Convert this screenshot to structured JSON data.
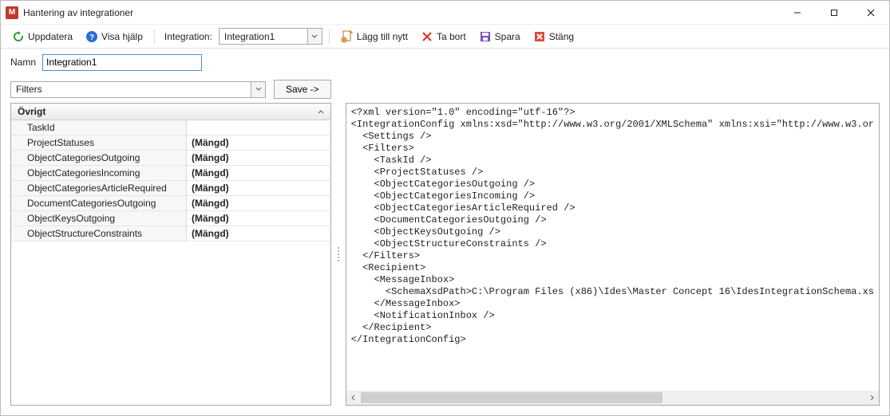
{
  "title": "Hantering av integrationer",
  "toolbar": {
    "update": "Uppdatera",
    "help": "Visa hjälp",
    "integration_label": "Integration:",
    "integration_value": "Integration1",
    "add_new": "Lägg till nytt",
    "delete": "Ta bort",
    "save": "Spara",
    "close": "Stäng"
  },
  "name_label": "Namn",
  "name_value": "Integration1",
  "filters_combo": "Filters",
  "save_arrow": "Save ->",
  "group_header": "Övrigt",
  "props": [
    {
      "key": "TaskId",
      "val": ""
    },
    {
      "key": "ProjectStatuses",
      "val": "(Mängd)"
    },
    {
      "key": "ObjectCategoriesOutgoing",
      "val": "(Mängd)"
    },
    {
      "key": "ObjectCategoriesIncoming",
      "val": "(Mängd)"
    },
    {
      "key": "ObjectCategoriesArticleRequired",
      "val": "(Mängd)"
    },
    {
      "key": "DocumentCategoriesOutgoing",
      "val": "(Mängd)"
    },
    {
      "key": "ObjectKeysOutgoing",
      "val": "(Mängd)"
    },
    {
      "key": "ObjectStructureConstraints",
      "val": "(Mängd)"
    }
  ],
  "xml": "<?xml version=\"1.0\" encoding=\"utf-16\"?>\n<IntegrationConfig xmlns:xsd=\"http://www.w3.org/2001/XMLSchema\" xmlns:xsi=\"http://www.w3.or\n  <Settings />\n  <Filters>\n    <TaskId />\n    <ProjectStatuses />\n    <ObjectCategoriesOutgoing />\n    <ObjectCategoriesIncoming />\n    <ObjectCategoriesArticleRequired />\n    <DocumentCategoriesOutgoing />\n    <ObjectKeysOutgoing />\n    <ObjectStructureConstraints />\n  </Filters>\n  <Recipient>\n    <MessageInbox>\n      <SchemaXsdPath>C:\\Program Files (x86)\\Ides\\Master Concept 16\\IdesIntegrationSchema.xs\n    </MessageInbox>\n    <NotificationInbox />\n  </Recipient>\n</IntegrationConfig>"
}
